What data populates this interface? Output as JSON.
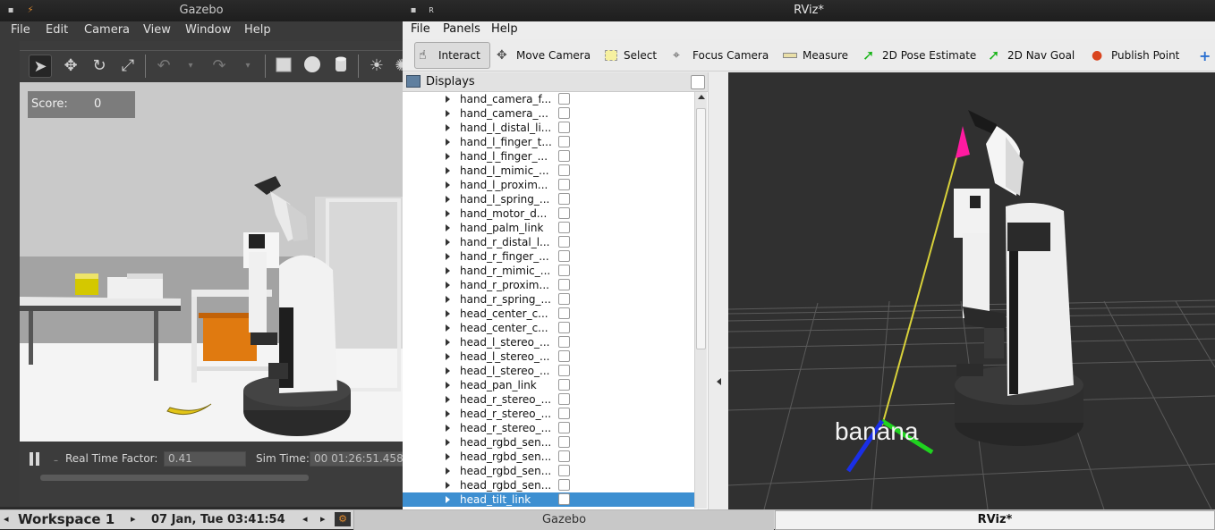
{
  "gazebo": {
    "title": "Gazebo",
    "menu": [
      "File",
      "Edit",
      "Camera",
      "View",
      "Window",
      "Help"
    ],
    "score_label": "Score:",
    "score_value": "0",
    "rtf_label": "Real Time Factor:",
    "rtf_value": "0.41",
    "sim_time_label": "Sim Time:",
    "sim_time_value": "00 01:26:51.458",
    "scene_label": "banana"
  },
  "rviz": {
    "title": "RViz*",
    "menu": [
      "File",
      "Panels",
      "Help"
    ],
    "tools": [
      "Interact",
      "Move Camera",
      "Select",
      "Focus Camera",
      "Measure",
      "2D Pose Estimate",
      "2D Nav Goal",
      "Publish Point"
    ],
    "displays_title": "Displays",
    "tree_items": [
      "hand_camera_f...",
      "hand_camera_...",
      "hand_l_distal_li...",
      "hand_l_finger_t...",
      "hand_l_finger_...",
      "hand_l_mimic_...",
      "hand_l_proxim...",
      "hand_l_spring_...",
      "hand_motor_d...",
      "hand_palm_link",
      "hand_r_distal_l...",
      "hand_r_finger_...",
      "hand_r_mimic_...",
      "hand_r_proxim...",
      "hand_r_spring_...",
      "head_center_c...",
      "head_center_c...",
      "head_l_stereo_...",
      "head_l_stereo_...",
      "head_l_stereo_...",
      "head_pan_link",
      "head_r_stereo_...",
      "head_r_stereo_...",
      "head_r_stereo_...",
      "head_rgbd_sen...",
      "head_rgbd_sen...",
      "head_rgbd_sen...",
      "head_rgbd_sen...",
      "head_tilt_link"
    ],
    "selected_item": "head_tilt_link",
    "marker_label": "banana"
  },
  "taskbar": {
    "workspace": "Workspace 1",
    "datetime": "07 Jan, Tue 03:41:54",
    "gazebo_task": "Gazebo",
    "rviz_task": "RViz*"
  }
}
